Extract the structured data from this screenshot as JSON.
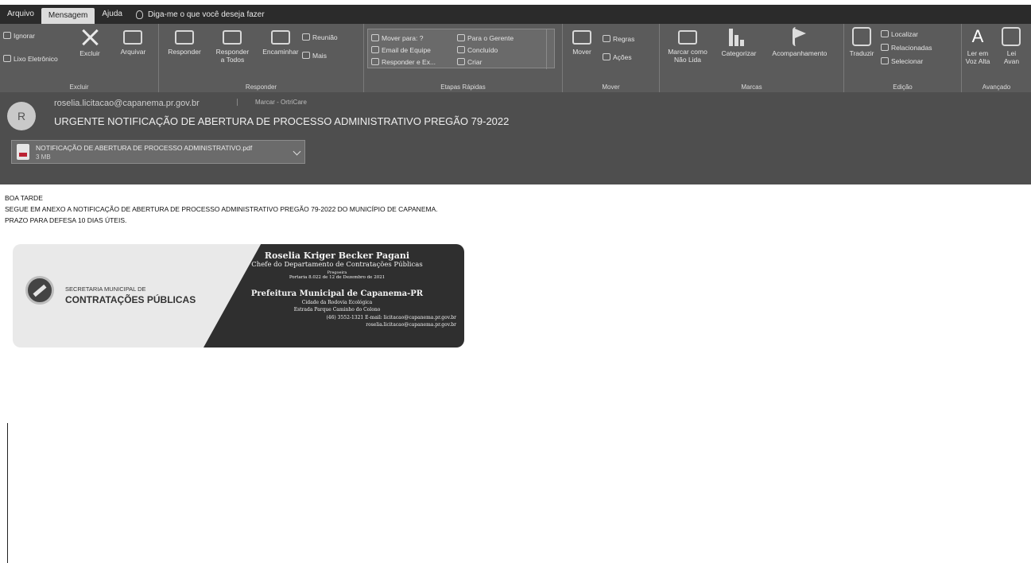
{
  "menu": {
    "tabs": [
      "Arquivo",
      "Mensagem",
      "Ajuda"
    ],
    "active_tab": "Mensagem",
    "tell_me": "Diga-me o que você deseja fazer"
  },
  "ribbon": {
    "excluir": {
      "ignorar": "Ignorar",
      "lixo": "Lixo Eletrônico",
      "excluir": "Excluir",
      "arquivar": "Arquivar",
      "label": "Excluir"
    },
    "responder": {
      "responder": "Responder",
      "responder_todos_1": "Responder",
      "responder_todos_2": "a Todos",
      "encaminhar": "Encaminhar",
      "reuniao": "Reunião",
      "mais": "Mais",
      "label": "Responder"
    },
    "etapas": {
      "mover_para": "Mover para: ?",
      "email_equipe": "Email de Equipe",
      "responder_ex": "Responder e Ex...",
      "para_gerente": "Para o Gerente",
      "concluido": "Concluído",
      "criar": "Criar",
      "label": "Etapas Rápidas"
    },
    "mover": {
      "mover": "Mover",
      "regras": "Regras",
      "acoes": "Ações",
      "label": "Mover"
    },
    "marcas": {
      "marcar_1": "Marcar como",
      "marcar_2": "Não Lida",
      "categorizar": "Categorizar",
      "acompanhamento": "Acompanhamento",
      "label": "Marcas"
    },
    "edicao": {
      "traduzir": "Traduzir",
      "localizar": "Localizar",
      "relacionadas": "Relacionadas",
      "selecionar": "Selecionar",
      "label": "Edição"
    },
    "avancado": {
      "ler_1": "Ler em",
      "ler_2": "Voz Alta",
      "leit_1": "Lei",
      "leit_2": "Avan",
      "label": "Avançado"
    }
  },
  "message": {
    "avatar_initial": "R",
    "sender": "roselia.licitacao@capanema.pr.gov.br",
    "marker": "Marcar - OrtriCare",
    "subject": "URGENTE NOTIFICAÇÃO DE ABERTURA DE PROCESSO ADMINISTRATIVO PREGÃO 79-2022",
    "attachment": {
      "name": "NOTIFICAÇÃO DE ABERTURA DE PROCESSO ADMINISTRATIVO.pdf",
      "size": "3 MB"
    }
  },
  "body": {
    "line1": "BOA TARDE",
    "line2": "SEGUE EM ANEXO A NOTIFICAÇÃO DE ABERTURA DE PROCESSO ADMINISTRATIVO PREGÃO 79-2022 DO MUNICÍPIO DE CAPANEMA.",
    "line3": "PRAZO PARA DEFESA 10 DIAS ÚTEIS."
  },
  "signature": {
    "secretaria_small": "SECRETARIA MUNICIPAL DE",
    "secretaria_big": "CONTRATAÇÕES PÚBLICAS",
    "name": "Roselia Kriger Becker Pagani",
    "role": "Chefe do Departamento de Contratações Públicas",
    "portaria_label": "Pregoeira",
    "portaria": "Portaria 8.022 de 12 de Dezembro de 2021",
    "org": "Prefeitura Municipal de Capanema-PR",
    "city": "Cidade da Rodovia Ecológica",
    "address": "Estrada Parque Caminho do Colono",
    "contact": "(46) 3552-1321 E-mail: licitacao@capanema.pr.gov.br",
    "email2": "roselia.licitacao@capanema.pr.gov.br"
  }
}
